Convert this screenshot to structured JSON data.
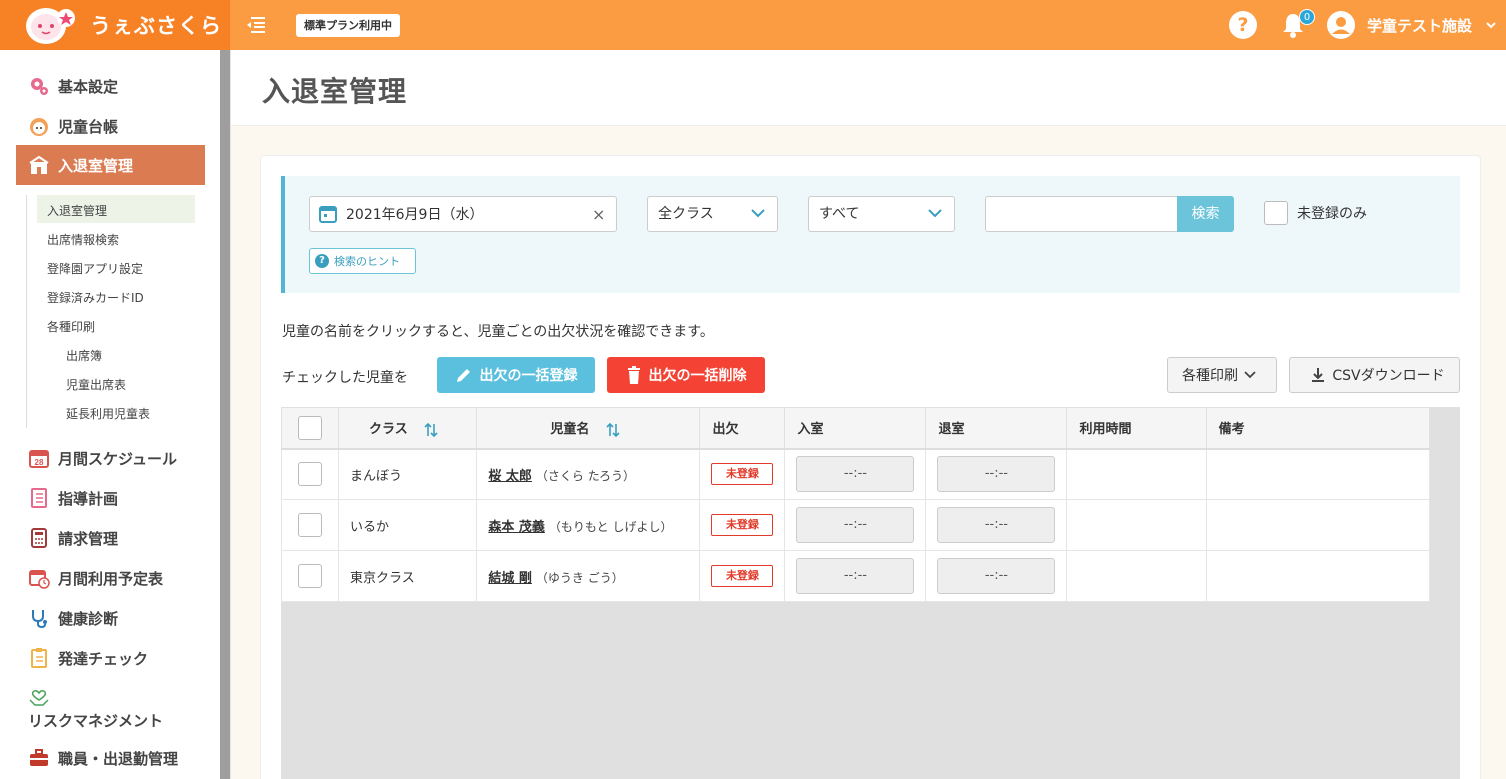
{
  "header": {
    "brand": "うぇぶさくら",
    "plan_badge": "標準プラン利用中",
    "help_glyph": "?",
    "notification_count": "0",
    "facility_name": "学童テスト施設"
  },
  "sidebar": {
    "items": [
      {
        "label": "基本設定",
        "icon": "gear-icon"
      },
      {
        "label": "児童台帳",
        "icon": "child-face-icon"
      },
      {
        "label": "入退室管理",
        "icon": "building-icon",
        "active": true
      },
      {
        "label": "月間スケジュール",
        "icon": "calendar-28-icon"
      },
      {
        "label": "指導計画",
        "icon": "notebook-icon"
      },
      {
        "label": "請求管理",
        "icon": "calculator-icon"
      },
      {
        "label": "月間利用予定表",
        "icon": "calendar-clock-icon"
      },
      {
        "label": "健康診断",
        "icon": "stethoscope-icon"
      },
      {
        "label": "発達チェック",
        "icon": "checklist-icon"
      },
      {
        "label": "リスクマネジメント",
        "icon": "hands-heart-icon"
      },
      {
        "label": "職員・出退勤管理",
        "icon": "briefcase-icon"
      }
    ],
    "subitems": [
      {
        "label": "入退室管理",
        "current": true
      },
      {
        "label": "出席情報検索"
      },
      {
        "label": "登降園アプリ設定"
      },
      {
        "label": "登録済みカードID"
      },
      {
        "label": "各種印刷"
      },
      {
        "label": "出席簿"
      },
      {
        "label": "児童出席表"
      },
      {
        "label": "延長利用児童表"
      }
    ]
  },
  "page": {
    "title": "入退室管理"
  },
  "filter": {
    "date_value": "2021年6月9日（水）",
    "clear_glyph": "×",
    "class_select": "全クラス",
    "status_select": "すべて",
    "search_value": "",
    "search_button": "検索",
    "unregistered_only_label": "未登録のみ",
    "hint_label": "検索のヒント"
  },
  "content": {
    "help_text": "児童の名前をクリックすると、児童ごとの出欠状況を確認できます。",
    "checked_label": "チェックした児童を",
    "bulk_register_button": "出欠の一括登録",
    "bulk_delete_button": "出欠の一括削除",
    "print_button": "各種印刷",
    "csv_button": "CSVダウンロード"
  },
  "table": {
    "headers": {
      "class": "クラス",
      "name": "児童名",
      "attendance": "出欠",
      "entry": "入室",
      "exit": "退室",
      "usage_time": "利用時間",
      "notes": "備考"
    },
    "rows": [
      {
        "class": "まんぼう",
        "name": "桜 太郎",
        "kana": "（さくら たろう）",
        "attendance": "未登録",
        "entry": "--:--",
        "exit": "--:--",
        "usage_time": "",
        "notes": ""
      },
      {
        "class": "いるか",
        "name": "森本 茂義",
        "kana": "（もりもと しげよし）",
        "attendance": "未登録",
        "entry": "--:--",
        "exit": "--:--",
        "usage_time": "",
        "notes": ""
      },
      {
        "class": "東京クラス",
        "name": "結城 剛",
        "kana": "（ゆうき ごう）",
        "attendance": "未登録",
        "entry": "--:--",
        "exit": "--:--",
        "usage_time": "",
        "notes": ""
      }
    ]
  },
  "colors": {
    "header_orange": "#fb9c42",
    "logo_orange": "#f78226",
    "active_nav": "#db7b52",
    "accent_blue": "#5bc0de",
    "danger_red": "#f44335"
  }
}
